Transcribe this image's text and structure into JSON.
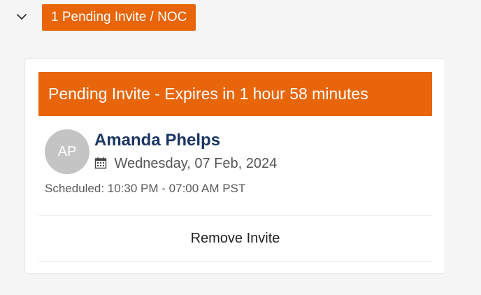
{
  "section": {
    "toggle_icon": "chevron-down-icon",
    "badge_label": "1 Pending Invite / NOC"
  },
  "invite_card": {
    "banner_text": "Pending Invite - Expires in 1 hour 58 minutes",
    "avatar_initials": "AP",
    "person_name": "Amanda Phelps",
    "date_icon": "calendar-icon",
    "date": "Wednesday, 07 Feb, 2024",
    "schedule": "Scheduled: 10:30 PM - 07:00 AM PST",
    "remove_label": "Remove Invite"
  },
  "colors": {
    "accent_orange": "#e8650a",
    "name_navy": "#1b3564",
    "avatar_gray": "#c4c4c4",
    "page_background": "#f5f5f5"
  }
}
